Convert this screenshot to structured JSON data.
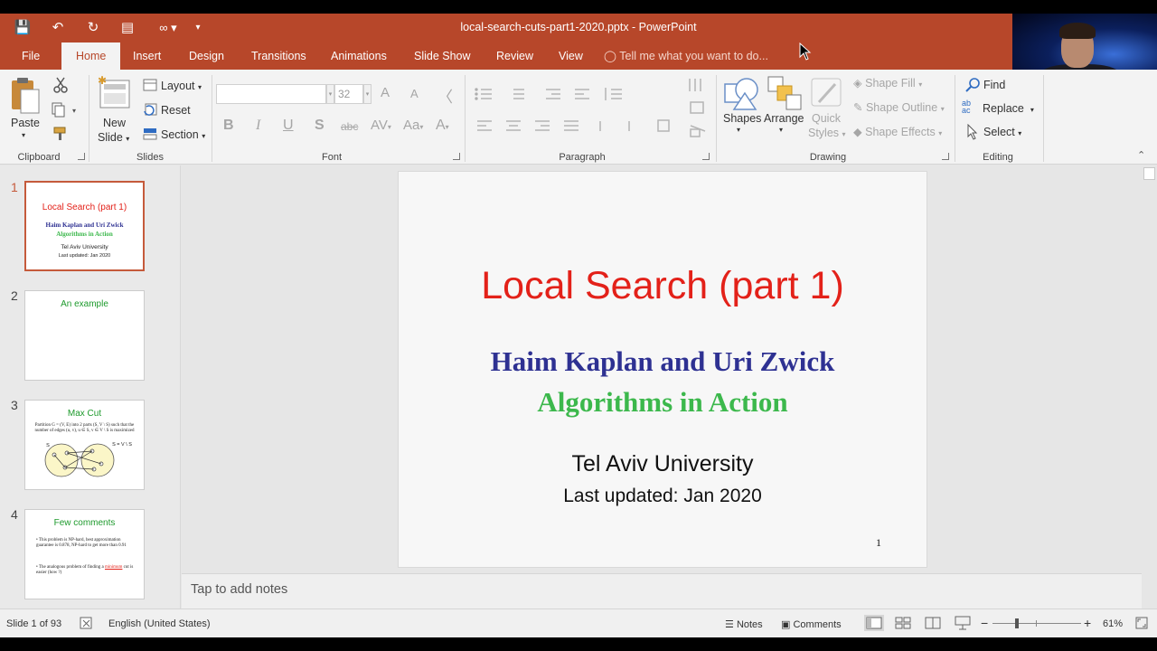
{
  "window": {
    "title": "local-search-cuts-part1-2020.pptx - PowerPoint"
  },
  "colors": {
    "accent": "#b7472a",
    "slide_title": "#e32119",
    "authors": "#2e3192",
    "course": "#3cb84c"
  },
  "quick_access": {
    "save": "💾",
    "undo": "↶",
    "redo": "↻",
    "present": "▤",
    "link": "∞ ▾",
    "more": "▾"
  },
  "tabs": [
    {
      "label": "File"
    },
    {
      "label": "Home"
    },
    {
      "label": "Insert"
    },
    {
      "label": "Design"
    },
    {
      "label": "Transitions"
    },
    {
      "label": "Animations"
    },
    {
      "label": "Slide Show"
    },
    {
      "label": "Review"
    },
    {
      "label": "View"
    }
  ],
  "tell_me": "Tell me what you want to do...",
  "ribbon": {
    "clipboard": {
      "paste": "Paste",
      "label": "Clipboard"
    },
    "slides": {
      "new_slide_1": "New",
      "new_slide_2": "Slide",
      "layout": "Layout",
      "reset": "Reset",
      "section": "Section",
      "label": "Slides"
    },
    "font": {
      "size": "32",
      "bold": "B",
      "italic": "I",
      "underline": "U",
      "shadow": "S",
      "strike": "abc",
      "spacing": "AV",
      "case": "Aa",
      "color": "A",
      "grow": "A",
      "shrink": "A",
      "label": "Font"
    },
    "paragraph": {
      "label": "Paragraph"
    },
    "drawing": {
      "shapes": "Shapes",
      "arrange": "Arrange",
      "quick_1": "Quick",
      "quick_2": "Styles",
      "fill": "Shape Fill",
      "outline": "Shape Outline",
      "effects": "Shape Effects",
      "label": "Drawing"
    },
    "editing": {
      "find": "Find",
      "replace": "Replace",
      "select": "Select",
      "label": "Editing"
    }
  },
  "thumbnails": [
    {
      "num": "1",
      "title": "Local Search (part 1)",
      "line1": "Haim Kaplan and Uri Zwick",
      "line2": "Algorithms in Action",
      "line3": "Tel Aviv University",
      "line4": "Last updated: Jan 2020"
    },
    {
      "num": "2",
      "title": "An example"
    },
    {
      "num": "3",
      "title": "Max Cut",
      "text": "Partition G = (V, E) into 2 parts (S, V \\ S) such that the number of edges (u, v), u ∈ S, v ∈ V \\ S is maximized",
      "label_s": "S",
      "label_vs": "S = V \\ S"
    },
    {
      "num": "4",
      "title": "Few comments",
      "b1": "This problem is NP-hard, best approximation guarantee is 0.878, NP-hard to get more than 0.91",
      "b2a": "The analogous problem of finding a ",
      "b2b": "minimum",
      "b2c": " cut is easier (how ?)"
    }
  ],
  "slide": {
    "title": "Local Search (part 1)",
    "authors": "Haim Kaplan and Uri Zwick",
    "course": "Algorithms in Action",
    "university": "Tel Aviv University",
    "updated": "Last updated: Jan 2020",
    "number": "1"
  },
  "notes_placeholder": "Tap to add notes",
  "status": {
    "slide_info": "Slide 1 of 93",
    "language": "English (United States)",
    "notes": "Notes",
    "comments": "Comments",
    "zoom": "61%"
  }
}
